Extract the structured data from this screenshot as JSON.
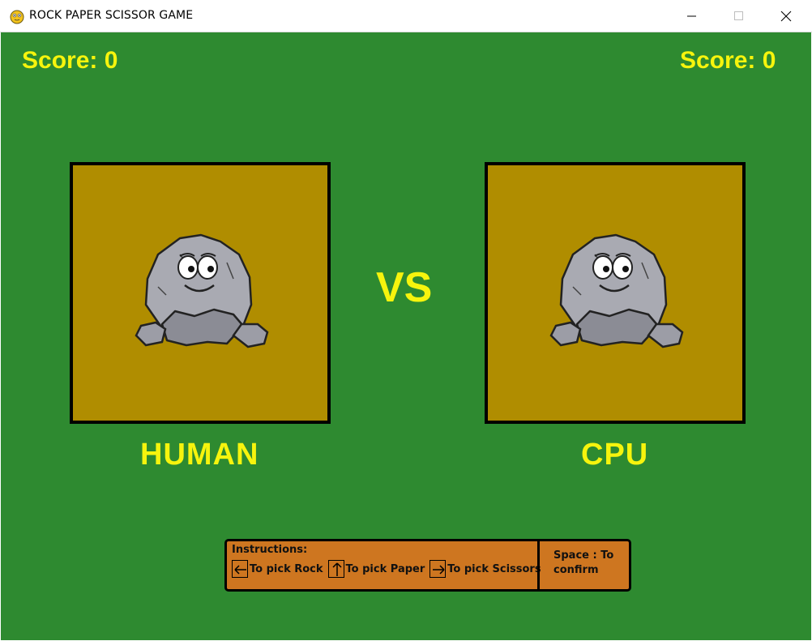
{
  "window": {
    "title": "ROCK PAPER SCISSOR GAME",
    "icon": "pygame-snake-icon",
    "controls": [
      "minimize-icon",
      "maximize-icon",
      "close-icon"
    ]
  },
  "scores": {
    "left": "Score: 0",
    "right": "Score: 0"
  },
  "players": {
    "human": {
      "label": "HUMAN",
      "choice": "rock"
    },
    "cpu": {
      "label": "CPU",
      "choice": "rock"
    }
  },
  "vs_text": "VS",
  "instructions": {
    "title": "Instructions:",
    "items": [
      {
        "key_icon": "left-arrow-icon",
        "text": "To pick Rock"
      },
      {
        "key_icon": "up-arrow-icon",
        "text": "To pick Paper"
      },
      {
        "key_icon": "right-arrow-icon",
        "text": "To pick Scissors"
      }
    ],
    "confirm": "Space : To confirm"
  },
  "colors": {
    "background": "#2e8a30",
    "text_yellow": "#f6f40d",
    "panel": "#b08d00",
    "instructions_bg": "#ce7620"
  }
}
